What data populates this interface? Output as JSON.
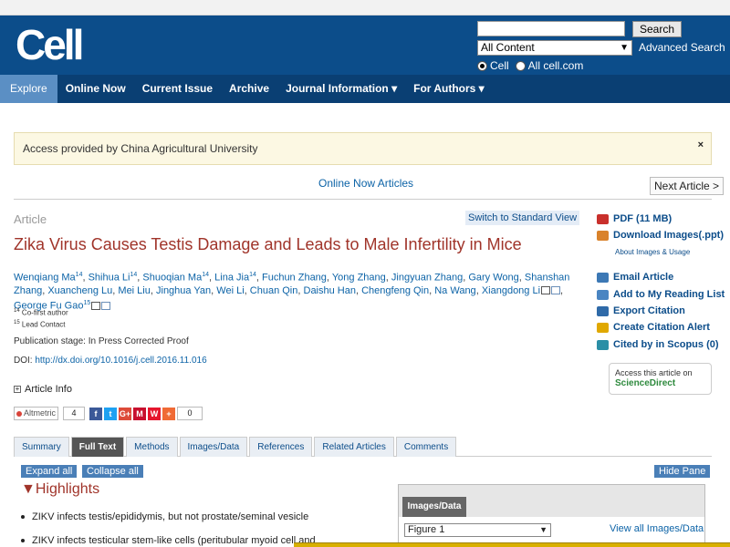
{
  "header": {
    "logo": "Cell",
    "search_button": "Search",
    "search_placeholder": "",
    "content_select": "All Content",
    "advanced_search": "Advanced Search",
    "radio_cell": "Cell",
    "radio_all": "All cell.com"
  },
  "nav": {
    "items": [
      "Explore",
      "Online Now",
      "Current Issue",
      "Archive",
      "Journal Information ▾",
      "For Authors ▾"
    ]
  },
  "notice": {
    "text": "Access provided by China Agricultural University",
    "close": "×"
  },
  "article_nav": {
    "online_now": "Online Now Articles",
    "next": "Next Article >"
  },
  "article": {
    "label": "Article",
    "switch_view": "Switch to Standard View",
    "title": "Zika Virus Causes Testis Damage and Leads to Male Infertility in Mice",
    "authors": [
      {
        "name": "Wenqiang Ma",
        "sup": "14"
      },
      {
        "name": "Shihua Li",
        "sup": "14"
      },
      {
        "name": "Shuoqian Ma",
        "sup": "14"
      },
      {
        "name": "Lina Jia",
        "sup": "14"
      },
      {
        "name": "Fuchun Zhang",
        "sup": ""
      },
      {
        "name": "Yong Zhang",
        "sup": ""
      },
      {
        "name": "Jingyuan Zhang",
        "sup": ""
      },
      {
        "name": "Gary Wong",
        "sup": ""
      },
      {
        "name": "Shanshan Zhang",
        "sup": ""
      },
      {
        "name": "Xuancheng Lu",
        "sup": ""
      },
      {
        "name": "Mei Liu",
        "sup": ""
      },
      {
        "name": "Jinghua Yan",
        "sup": ""
      },
      {
        "name": "Wei Li",
        "sup": ""
      },
      {
        "name": "Chuan Qin",
        "sup": ""
      },
      {
        "name": "Daishu Han",
        "sup": ""
      },
      {
        "name": "Chengfeng Qin",
        "sup": ""
      },
      {
        "name": "Na Wang",
        "sup": ""
      },
      {
        "name": "Xiangdong Li",
        "sup": ""
      },
      {
        "name": "George Fu Gao",
        "sup": "15"
      }
    ],
    "footnote_1_sup": "14",
    "footnote_1": "Co-first author",
    "footnote_2_sup": "15",
    "footnote_2": "Lead Contact",
    "publication_stage": "Publication stage: In Press Corrected Proof",
    "doi_label": "DOI:",
    "doi_link": "http://dx.doi.org/10.1016/j.cell.2016.11.016",
    "article_info": "Article Info"
  },
  "share": {
    "altmetric_label": "Altmetric",
    "altmetric_score": "4",
    "buttons": [
      {
        "glyph": "f",
        "color": "#3b5998"
      },
      {
        "glyph": "t",
        "color": "#1da1f2"
      },
      {
        "glyph": "G+",
        "color": "#dd4b39"
      },
      {
        "glyph": "M",
        "color": "#c8102e"
      },
      {
        "glyph": "W",
        "color": "#e6162d"
      },
      {
        "glyph": "+",
        "color": "#f06a35"
      }
    ],
    "share_count": "0"
  },
  "tabs": [
    "Summary",
    "Full Text",
    "Methods",
    "Images/Data",
    "References",
    "Related Articles",
    "Comments"
  ],
  "content": {
    "expand_all": "Expand all",
    "collapse_all": "Collapse all",
    "hide_pane": "Hide Pane",
    "highlights_title": "▼Highlights",
    "highlights": [
      "ZIKV infects testis/epididymis, but not prostate/seminal vesicle",
      "ZIKV infects testicular stem-like cells (peritubular myoid cell and"
    ]
  },
  "images_panel": {
    "tab": "Images/Data",
    "figure_select": "Figure 1",
    "view_all": "View all Images/Data"
  },
  "sidebar": {
    "pdf": "PDF (11 MB)",
    "download_images": "Download Images(.ppt)",
    "about_images": "About Images & Usage",
    "email": "Email Article",
    "reading_list": "Add to My Reading List",
    "export": "Export Citation",
    "alert": "Create Citation Alert",
    "scopus": "Cited by in Scopus (0)",
    "sd_line1": "Access this article on",
    "sd_line2": "ScienceDirect"
  }
}
